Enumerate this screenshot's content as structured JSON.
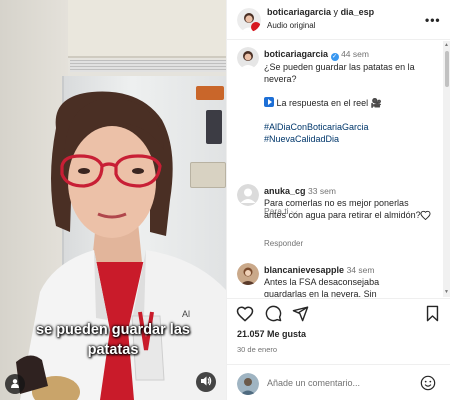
{
  "video": {
    "caption_line1": "se pueden guardar las",
    "caption_line2": "patatas"
  },
  "header": {
    "owner": "boticariagarcia",
    "conjunction": "y",
    "collaborator": "dia_esp",
    "audio": "Audio original",
    "more_icon": "more-horizontal-icon"
  },
  "post": {
    "author": "boticariagarcia",
    "time": "44 sem",
    "question": "¿Se pueden guardar las patatas en la nevera?",
    "answer_text": "La respuesta en el reel",
    "hashtag1": "#AlDiaConBoticariaGarcia",
    "hashtag2": "#NuevaCalidadDia",
    "for_you": "Para ti"
  },
  "comments": [
    {
      "user": "anuka_cg",
      "time": "33 sem",
      "text": "Para comerlas no es mejor ponerlas antes con agua para retirar el almidón?",
      "reply": "Responder"
    },
    {
      "user": "blancanievesapple",
      "time": "34 sem",
      "text": "Antes la FSA desaconsejaba guardarlas en la nevera. Sin"
    }
  ],
  "actions": {
    "likes_count": "21.057",
    "likes_label": "Me gusta",
    "date": "30 de enero"
  },
  "composer": {
    "placeholder": "Añade un comentario..."
  },
  "colors": {
    "link": "#00376b",
    "verified": "#3897f0",
    "muted": "#737373"
  }
}
